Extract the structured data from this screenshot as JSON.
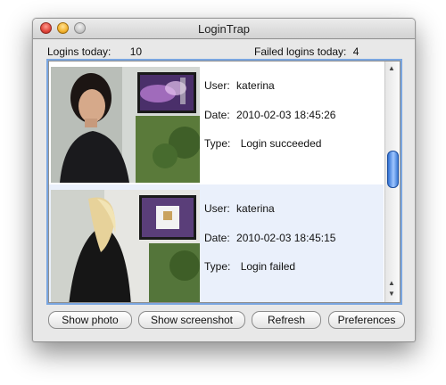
{
  "window": {
    "title": "LoginTrap"
  },
  "stats": {
    "logins_label": "Logins today:",
    "logins_value": "10",
    "failed_label": "Failed logins today:",
    "failed_value": "4"
  },
  "entries": [
    {
      "user_label": "User:",
      "user": "katerina",
      "date_label": "Date:",
      "date": "2010-02-03 18:45:26",
      "type_label": "Type:",
      "type": "Login succeeded"
    },
    {
      "user_label": "User:",
      "user": "katerina",
      "date_label": "Date:",
      "date": "2010-02-03 18:45:15",
      "type_label": "Type:",
      "type": "Login failed"
    }
  ],
  "buttons": {
    "show_photo": "Show photo",
    "show_screenshot": "Show screenshot",
    "refresh": "Refresh",
    "preferences": "Preferences"
  },
  "colors": {
    "selection_row": "#eaf0fb",
    "focus_ring": "#7aa6e0",
    "scroll_thumb": "#3b7ad6"
  }
}
